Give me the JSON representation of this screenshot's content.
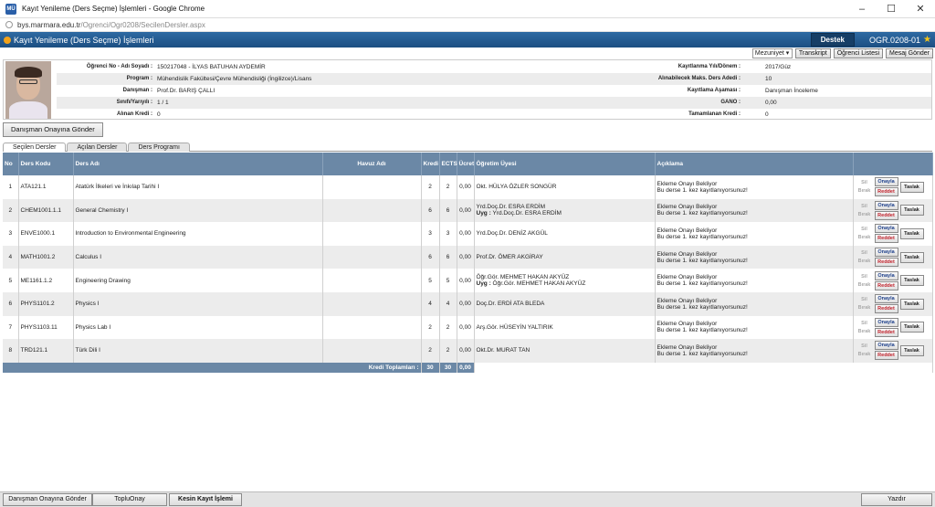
{
  "window": {
    "title": "Kayıt Yenileme (Ders Seçme) İşlemleri - Google Chrome",
    "icon_text": "MÜ"
  },
  "address": {
    "host": "bys.marmara.edu.tr",
    "path": "/Ogrenci/Ogr0208/SecilenDersler.aspx"
  },
  "appbar": {
    "title": "Kayıt Yenileme (Ders Seçme) İşlemleri",
    "destek": "Destek",
    "code": "OGR.0208-01"
  },
  "top_buttons": {
    "select": "Mezuniyet",
    "transkript": "Transkript",
    "ogrenci_listesi": "Öğrenci Listesi",
    "mesaj": "Mesaj Gönder"
  },
  "profile": {
    "no_label": "Öğrenci No - Adı Soyadı :",
    "no_value": "150217048 - İLYAS BATUHAN AYDEMİR",
    "program_label": "Program :",
    "program_value": "Mühendislik Fakültesi/Çevre Mühendisliği (İngilizce)/Lisans",
    "danisman_label": "Danışman :",
    "danisman_value": "Prof.Dr. BARIŞ ÇALLI",
    "sinif_label": "Sınıfı/Yarıyılı :",
    "sinif_value": "1 / 1",
    "alinan_label": "Alınan Kredi :",
    "alinan_value": "0",
    "kayitlanma_label": "Kayıtlanma Yılı/Dönem :",
    "kayitlanma_value": "2017/Güz",
    "maks_label": "Alınabilecek Maks. Ders Adedi :",
    "maks_value": "10",
    "asama_label": "Kayıtlama Aşaması :",
    "asama_value": "Danışman İnceleme",
    "gano_label": "GANO :",
    "gano_value": "0,00",
    "tamam_label": "Tamamlanan Kredi :",
    "tamam_value": "0"
  },
  "gonder_button": "Danışman Onayına Gönder",
  "tabs": [
    "Seçilen Dersler",
    "Açılan Dersler",
    "Ders Programı"
  ],
  "columns": [
    "No",
    "Ders Kodu",
    "Ders Adı",
    "Havuz Adı",
    "Kredi",
    "ECTS",
    "Ücret",
    "Öğretim Üyesi",
    "Açıklama"
  ],
  "actions": {
    "sil": "Sil",
    "birak": "Bırak",
    "onayla": "Onayla",
    "reddet": "Reddet",
    "taslak": "Taslak"
  },
  "rows": [
    {
      "no": "1",
      "kod": "ATA121.1",
      "ad": "Atatürk İlkeleri ve İnkılap Tarihi I",
      "havuz": "",
      "kredi": "2",
      "ects": "2",
      "ucret": "0,00",
      "uye1": "Okt. HÜLYA ÖZLER SONGÜR",
      "uye2": "",
      "ac1": "Ekleme Onayı Bekliyor",
      "ac2": "Bu derse 1. kez kayıtlanıyorsunuz!"
    },
    {
      "no": "2",
      "kod": "CHEM1001.1.1",
      "ad": "General Chemistry I",
      "havuz": "",
      "kredi": "6",
      "ects": "6",
      "ucret": "0,00",
      "uye1": "Yrd.Doç.Dr. ESRA ERDİM",
      "uye2": "Uyg : Yrd.Doç.Dr. ESRA ERDİM",
      "ac1": "Ekleme Onayı Bekliyor",
      "ac2": "Bu derse 1. kez kayıtlanıyorsunuz!"
    },
    {
      "no": "3",
      "kod": "ENVE1000.1",
      "ad": "Introduction to Environmental Engineering",
      "havuz": "",
      "kredi": "3",
      "ects": "3",
      "ucret": "0,00",
      "uye1": "Yrd.Doç.Dr. DENİZ AKGÜL",
      "uye2": "",
      "ac1": "Ekleme Onayı Bekliyor",
      "ac2": "Bu derse 1. kez kayıtlanıyorsunuz!"
    },
    {
      "no": "4",
      "kod": "MATH1001.2",
      "ad": "Calculus I",
      "havuz": "",
      "kredi": "6",
      "ects": "6",
      "ucret": "0,00",
      "uye1": "Prof.Dr. ÖMER AKGİRAY",
      "uye2": "",
      "ac1": "Ekleme Onayı Bekliyor",
      "ac2": "Bu derse 1. kez kayıtlanıyorsunuz!"
    },
    {
      "no": "5",
      "kod": "ME1161.1.2",
      "ad": "Engineering Drawing",
      "havuz": "",
      "kredi": "5",
      "ects": "5",
      "ucret": "0,00",
      "uye1": "Öğr.Gör. MEHMET HAKAN AKYÜZ",
      "uye2": "Uyg : Öğr.Gör. MEHMET HAKAN AKYÜZ",
      "ac1": "Ekleme Onayı Bekliyor",
      "ac2": "Bu derse 1. kez kayıtlanıyorsunuz!"
    },
    {
      "no": "6",
      "kod": "PHYS1101.2",
      "ad": "Physics I",
      "havuz": "",
      "kredi": "4",
      "ects": "4",
      "ucret": "0,00",
      "uye1": "Doç.Dr. ERDİ ATA BLEDA",
      "uye2": "",
      "ac1": "Ekleme Onayı Bekliyor",
      "ac2": "Bu derse 1. kez kayıtlanıyorsunuz!"
    },
    {
      "no": "7",
      "kod": "PHYS1103.11",
      "ad": "Physics Lab I",
      "havuz": "",
      "kredi": "2",
      "ects": "2",
      "ucret": "0,00",
      "uye1": "Arş.Gör. HÜSEYİN YALTIRIK",
      "uye2": "",
      "ac1": "Ekleme Onayı Bekliyor",
      "ac2": "Bu derse 1. kez kayıtlanıyorsunuz!"
    },
    {
      "no": "8",
      "kod": "TRD121.1",
      "ad": "Türk Dili I",
      "havuz": "",
      "kredi": "2",
      "ects": "2",
      "ucret": "0,00",
      "uye1": "Okt.Dr. MURAT TAN",
      "uye2": "",
      "ac1": "Ekleme Onayı Bekliyor",
      "ac2": "Bu derse 1. kez kayıtlanıyorsunuz!"
    }
  ],
  "totals": {
    "label": "Kredi Toplamları :",
    "kredi": "30",
    "ects": "30",
    "ucret": "0,00"
  },
  "bottom": {
    "gonder": "Danışman Onayına Gönder",
    "toplu": "TopluOnay",
    "kesin": "Kesin Kayıt İşlemi",
    "yazdir": "Yazdır"
  }
}
